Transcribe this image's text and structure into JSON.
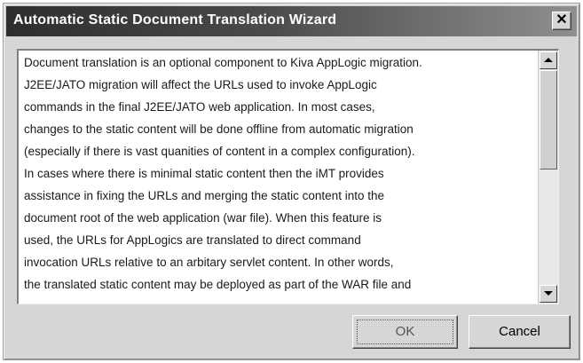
{
  "window": {
    "title": "Automatic Static Document Translation Wizard",
    "close_glyph": "✕",
    "close_icon": "close-icon"
  },
  "body": {
    "lines": [
      "Document translation is an optional component to Kiva AppLogic migration.",
      "J2EE/JATO migration will affect the URLs used to invoke AppLogic",
      "commands in the final J2EE/JATO web application.  In most cases,",
      "changes to the static content will be done offline from automatic migration",
      "(especially if there is vast quanities of content in a complex configuration).",
      " In cases where there is minimal static content then the iMT provides",
      "assistance in fixing the URLs  and merging the static content into the",
      "document root of  the web application (war file).  When this feature is",
      "used, the URLs for AppLogics are translated to direct command",
      "invocation URLs relative to an arbitary servlet content.  In other words,",
      "the translated static content may be deployed as part of the WAR file and"
    ]
  },
  "scrollbar": {
    "up_icon": "arrow-up-icon",
    "down_icon": "arrow-down-icon"
  },
  "buttons": {
    "ok_label": "OK",
    "cancel_label": "Cancel"
  },
  "colors": {
    "titlebar_start": "#2e2e2e",
    "titlebar_end": "#8f8f8f",
    "dialog_bg": "#d6d6d6"
  }
}
